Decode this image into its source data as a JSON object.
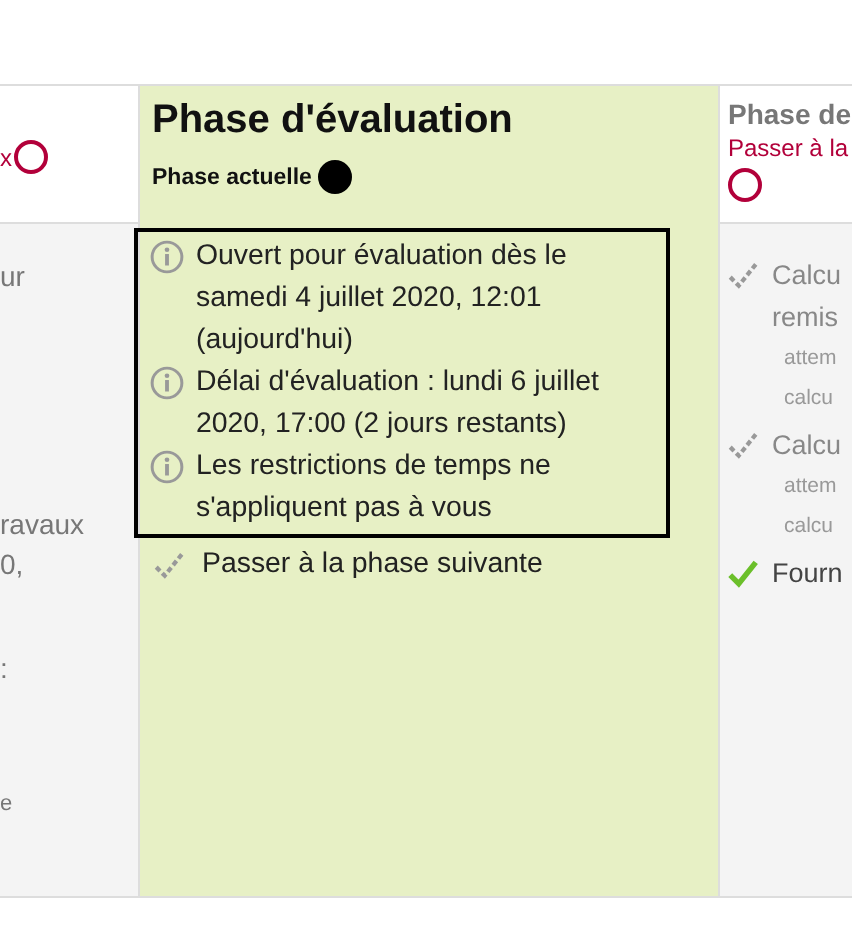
{
  "columns": [
    {
      "kind": "cut-left",
      "action": "x",
      "current": false,
      "lines": [
        "ur",
        "ravaux",
        "0,",
        ":",
        "e"
      ]
    },
    {
      "kind": "full",
      "title": "Phase d'évaluation",
      "status": "Phase actuelle",
      "current": true,
      "info": [
        "Ouvert pour évaluation dès le samedi 4 juillet 2020, 12:01 (aujourd'hui)",
        "Délai d'évaluation : lundi 6 juillet 2020, 17:00 (2 jours restants)",
        "Les restrictions de temps ne s'appliquent pas à vous"
      ],
      "tasks": [
        {
          "lines": [
            "Passer à la phase suivante"
          ],
          "done": false
        }
      ]
    },
    {
      "kind": "cut-right",
      "title": "Phase de",
      "action": "Passer à la",
      "current": false,
      "tasks": [
        {
          "lines": [
            "Calcu",
            "remis"
          ],
          "details": [
            "attem",
            "calcu"
          ],
          "done": false
        },
        {
          "lines": [
            "Calcu"
          ],
          "details": [
            "attem",
            "calcu"
          ],
          "done": false
        },
        {
          "lines": [
            "Fourn"
          ],
          "done": true
        }
      ]
    }
  ]
}
